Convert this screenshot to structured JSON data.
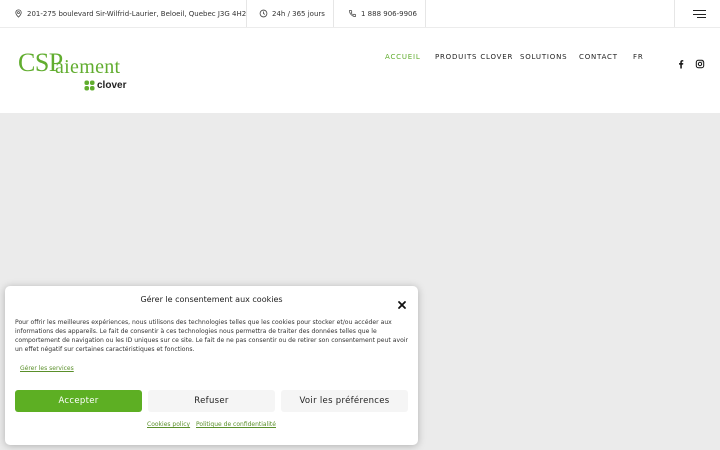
{
  "topbar": {
    "address": "201-275 boulevard Sir-Wilfrid-Laurier, Beloeil, Quebec J3G 4H2",
    "hours": "24h / 365 jours",
    "phone": "1 888 906-9906",
    "icons": [
      "location-pin-icon",
      "clock-icon",
      "phone-icon",
      "hamburger-menu-icon"
    ]
  },
  "logo": {
    "cs": "CSP",
    "rest": "aiement",
    "clover": "clover"
  },
  "nav": {
    "items": [
      {
        "label": "ACCUEIL",
        "active": true
      },
      {
        "label": "PRODUITS CLOVER",
        "active": false
      },
      {
        "label": "SOLUTIONS",
        "active": false
      },
      {
        "label": "CONTACT",
        "active": false
      },
      {
        "label": "FR",
        "active": false
      }
    ],
    "social": [
      "facebook-icon",
      "instagram-icon"
    ]
  },
  "cookie_modal": {
    "title": "Gérer le consentement aux cookies",
    "body": "Pour offrir les meilleures expériences, nous utilisons des technologies telles que les cookies pour stocker et/ou accéder aux informations des appareils. Le fait de consentir à ces technologies nous permettra de traiter des données telles que le comportement de navigation ou les ID uniques sur ce site. Le fait de ne pas consentir ou de retirer son consentement peut avoir un effet négatif sur certaines caractéristiques et fonctions.",
    "manage_link": "Gérer les services",
    "accept": "Accepter",
    "refuse": "Refuser",
    "preferences": "Voir les préférences",
    "cookies_policy": "Cookies policy",
    "privacy_policy": "Politique de confidentialité"
  },
  "colors": {
    "brand_green": "#61ad2f",
    "accept_button": "#5daf23",
    "page_background": "#ebebeb"
  }
}
